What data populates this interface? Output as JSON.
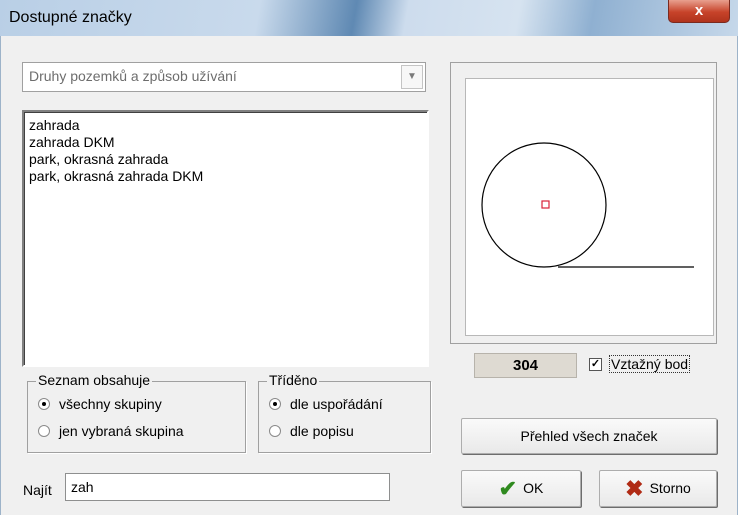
{
  "window": {
    "title": "Dostupné značky",
    "close_symbol": "x"
  },
  "category_select": {
    "selected": "Druhy pozemků a způsob užívání"
  },
  "list": {
    "items": [
      "zahrada",
      "zahrada DKM",
      "park, okrasná zahrada",
      "park, okrasná zahrada DKM"
    ]
  },
  "list_contains": {
    "label": "Seznam obsahuje",
    "options": [
      {
        "label": "všechny skupiny",
        "checked": true
      },
      {
        "label": "jen vybraná skupina",
        "checked": false
      }
    ]
  },
  "sorted": {
    "label": "Tříděno",
    "options": [
      {
        "label": "dle uspořádání",
        "checked": true
      },
      {
        "label": "dle popisu",
        "checked": false
      }
    ]
  },
  "search": {
    "label": "Najít",
    "value": "zah"
  },
  "preview": {
    "symbol_number": "304",
    "reference_point_label": "Vztažný bod",
    "reference_point_checked": true,
    "symbol_color": "#000000",
    "reference_marker_color": "#d9233a"
  },
  "buttons": {
    "overview": "Přehled všech značek",
    "ok": "OK",
    "cancel": "Storno"
  },
  "colors": {
    "ok_icon": "#2f8a1f",
    "cancel_icon": "#b02a14"
  }
}
